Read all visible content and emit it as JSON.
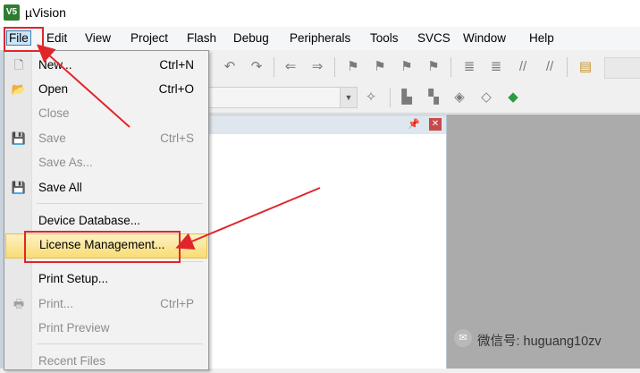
{
  "window": {
    "title": "µVision",
    "app_icon": "keil-uvision-icon",
    "icon_text": "V5"
  },
  "menubar": {
    "items": [
      "File",
      "Edit",
      "View",
      "Project",
      "Flash",
      "Debug",
      "Peripherals",
      "Tools",
      "SVCS",
      "Window",
      "Help"
    ],
    "active": "File"
  },
  "file_menu": {
    "items": [
      {
        "label": "New...",
        "shortcut": "Ctrl+N",
        "icon": "new-file-icon",
        "enabled": true
      },
      {
        "label": "Open",
        "shortcut": "Ctrl+O",
        "icon": "open-folder-icon",
        "enabled": true
      },
      {
        "label": "Close",
        "shortcut": "",
        "icon": "",
        "enabled": false
      },
      {
        "label": "Save",
        "shortcut": "Ctrl+S",
        "icon": "save-icon",
        "enabled": false
      },
      {
        "label": "Save As...",
        "shortcut": "",
        "icon": "",
        "enabled": false
      },
      {
        "label": "Save All",
        "shortcut": "",
        "icon": "save-all-icon",
        "enabled": true
      },
      {
        "label": "Device Database...",
        "shortcut": "",
        "icon": "",
        "enabled": true
      },
      {
        "label": "License Management...",
        "shortcut": "",
        "icon": "",
        "enabled": true,
        "highlighted": true
      },
      {
        "label": "Print Setup...",
        "shortcut": "",
        "icon": "",
        "enabled": true
      },
      {
        "label": "Print...",
        "shortcut": "Ctrl+P",
        "icon": "print-icon",
        "enabled": false
      },
      {
        "label": "Print Preview",
        "shortcut": "",
        "icon": "",
        "enabled": false
      },
      {
        "label": "Recent Files",
        "shortcut": "",
        "icon": "",
        "enabled": false
      }
    ]
  },
  "toolbar": {
    "row1_icons": [
      "undo-icon",
      "redo-icon",
      "nav-back-icon",
      "nav-forward-icon",
      "bookmark-icon",
      "prev-bookmark-icon",
      "next-bookmark-icon",
      "clear-bookmarks-icon",
      "indent-icon",
      "unindent-icon",
      "comment-icon",
      "uncomment-icon",
      "find-in-files-icon"
    ],
    "row2_icons": [
      "wizard-icon",
      "manage-components-icon",
      "select-packs-icon",
      "options-icon",
      "pack-installer-icon",
      "software-packs-icon"
    ]
  },
  "project_panel": {
    "pin_icon": "pin-icon",
    "close_icon": "close-icon"
  },
  "watermark": {
    "text": "微信号: huguang10zv",
    "icon": "wechat-icon"
  },
  "colors": {
    "annotation_red": "#e0262a",
    "highlight_yellow": "#f9dc74",
    "menu_active_blue": "#cce4f7"
  }
}
